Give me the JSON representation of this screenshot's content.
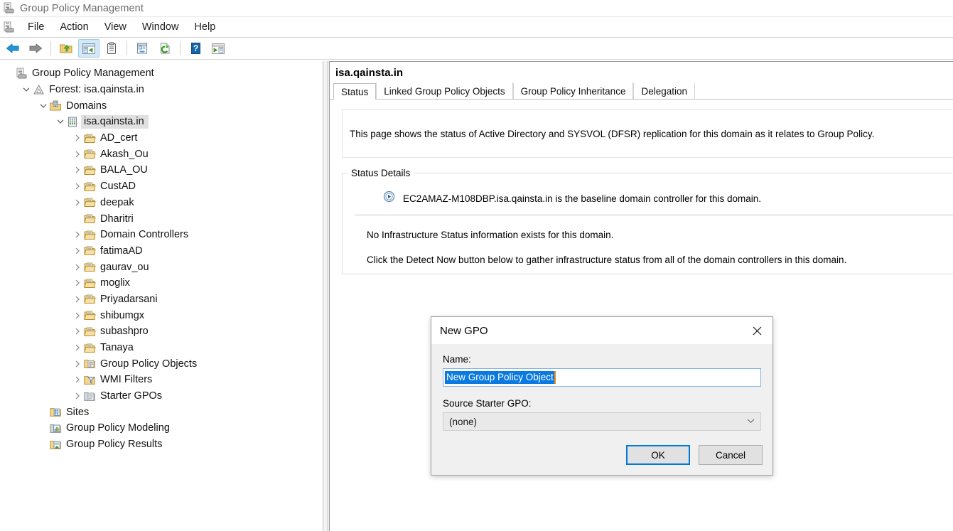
{
  "window": {
    "title": "Group Policy Management",
    "app_icon": "gpmc-icon"
  },
  "menubar": {
    "items": [
      {
        "label": "File",
        "name": "menu-file"
      },
      {
        "label": "Action",
        "name": "menu-action"
      },
      {
        "label": "View",
        "name": "menu-view"
      },
      {
        "label": "Window",
        "name": "menu-window"
      },
      {
        "label": "Help",
        "name": "menu-help"
      }
    ]
  },
  "toolbar": {
    "buttons": [
      {
        "icon": "back-arrow-icon",
        "pressed": false
      },
      {
        "icon": "forward-arrow-icon",
        "pressed": false
      },
      {
        "sep": true
      },
      {
        "icon": "up-folder-icon",
        "pressed": false
      },
      {
        "icon": "show-hide-tree-icon",
        "pressed": true
      },
      {
        "icon": "properties-icon",
        "pressed": false
      },
      {
        "sep": true
      },
      {
        "icon": "export-list-icon",
        "pressed": false
      },
      {
        "icon": "refresh-icon",
        "pressed": false
      },
      {
        "sep": true
      },
      {
        "icon": "help-icon",
        "pressed": false
      },
      {
        "icon": "show-console-tree-icon",
        "pressed": false
      }
    ]
  },
  "tree": {
    "nodes": [
      {
        "label": "Group Policy Management",
        "indent": 0,
        "twist": "none",
        "icon": "gpmc-icon",
        "selected": false
      },
      {
        "label": "Forest: isa.qainsta.in",
        "indent": 1,
        "twist": "expanded",
        "icon": "forest-icon",
        "selected": false
      },
      {
        "label": "Domains",
        "indent": 2,
        "twist": "expanded",
        "icon": "domains-icon",
        "selected": false
      },
      {
        "label": "isa.qainsta.in",
        "indent": 3,
        "twist": "expanded",
        "icon": "domain-icon",
        "selected": true
      },
      {
        "label": "AD_cert",
        "indent": 4,
        "twist": "collapsed",
        "icon": "ou-icon",
        "selected": false
      },
      {
        "label": "Akash_Ou",
        "indent": 4,
        "twist": "collapsed",
        "icon": "ou-icon",
        "selected": false
      },
      {
        "label": "BALA_OU",
        "indent": 4,
        "twist": "collapsed",
        "icon": "ou-icon",
        "selected": false
      },
      {
        "label": "CustAD",
        "indent": 4,
        "twist": "collapsed",
        "icon": "ou-icon",
        "selected": false
      },
      {
        "label": "deepak",
        "indent": 4,
        "twist": "collapsed",
        "icon": "ou-icon",
        "selected": false
      },
      {
        "label": "Dharitri",
        "indent": 4,
        "twist": "none",
        "icon": "ou-icon",
        "selected": false
      },
      {
        "label": "Domain Controllers",
        "indent": 4,
        "twist": "collapsed",
        "icon": "ou-icon",
        "selected": false
      },
      {
        "label": "fatimaAD",
        "indent": 4,
        "twist": "collapsed",
        "icon": "ou-icon",
        "selected": false
      },
      {
        "label": "gaurav_ou",
        "indent": 4,
        "twist": "collapsed",
        "icon": "ou-icon",
        "selected": false
      },
      {
        "label": "moglix",
        "indent": 4,
        "twist": "collapsed",
        "icon": "ou-icon",
        "selected": false
      },
      {
        "label": "Priyadarsani",
        "indent": 4,
        "twist": "collapsed",
        "icon": "ou-icon",
        "selected": false
      },
      {
        "label": "shibumgx",
        "indent": 4,
        "twist": "collapsed",
        "icon": "ou-icon",
        "selected": false
      },
      {
        "label": "subashpro",
        "indent": 4,
        "twist": "collapsed",
        "icon": "ou-icon",
        "selected": false
      },
      {
        "label": "Tanaya",
        "indent": 4,
        "twist": "collapsed",
        "icon": "ou-icon",
        "selected": false
      },
      {
        "label": "Group Policy Objects",
        "indent": 4,
        "twist": "collapsed",
        "icon": "gpo-folder-icon",
        "selected": false
      },
      {
        "label": "WMI Filters",
        "indent": 4,
        "twist": "collapsed",
        "icon": "wmi-filter-icon",
        "selected": false
      },
      {
        "label": "Starter GPOs",
        "indent": 4,
        "twist": "collapsed",
        "icon": "starter-gpo-icon",
        "selected": false
      },
      {
        "label": "Sites",
        "indent": 2,
        "twist": "none",
        "icon": "sites-icon",
        "selected": false
      },
      {
        "label": "Group Policy Modeling",
        "indent": 2,
        "twist": "none",
        "icon": "gp-modeling-icon",
        "selected": false
      },
      {
        "label": "Group Policy Results",
        "indent": 2,
        "twist": "none",
        "icon": "gp-results-icon",
        "selected": false
      }
    ]
  },
  "content": {
    "header": "isa.qainsta.in",
    "tabs": [
      {
        "label": "Status",
        "active": true
      },
      {
        "label": "Linked Group Policy Objects",
        "active": false
      },
      {
        "label": "Group Policy Inheritance",
        "active": false
      },
      {
        "label": "Delegation",
        "active": false
      }
    ],
    "intro": "This page shows the status of Active Directory and SYSVOL (DFSR) replication for this domain as it relates to Group Policy.",
    "status_group_legend": "Status Details",
    "baseline_dc": "EC2AMAZ-M108DBP.isa.qainsta.in is the baseline domain controller for this domain.",
    "no_infra": "No Infrastructure Status information exists for this domain.",
    "detect_hint": "Click the Detect Now button below to gather infrastructure status from all of the domain controllers in this domain."
  },
  "dialog": {
    "title": "New GPO",
    "close_icon": "close-icon",
    "name_label": "Name:",
    "name_value": "New Group Policy Object",
    "source_label": "Source Starter GPO:",
    "source_value": "(none)",
    "ok_label": "OK",
    "cancel_label": "Cancel"
  },
  "colors": {
    "selection_blue": "#0a7ae0",
    "focus_blue": "#0078d7",
    "tree_selected_bg": "#e0e0e0",
    "toolbar_pressed": "#d3e9f7"
  }
}
